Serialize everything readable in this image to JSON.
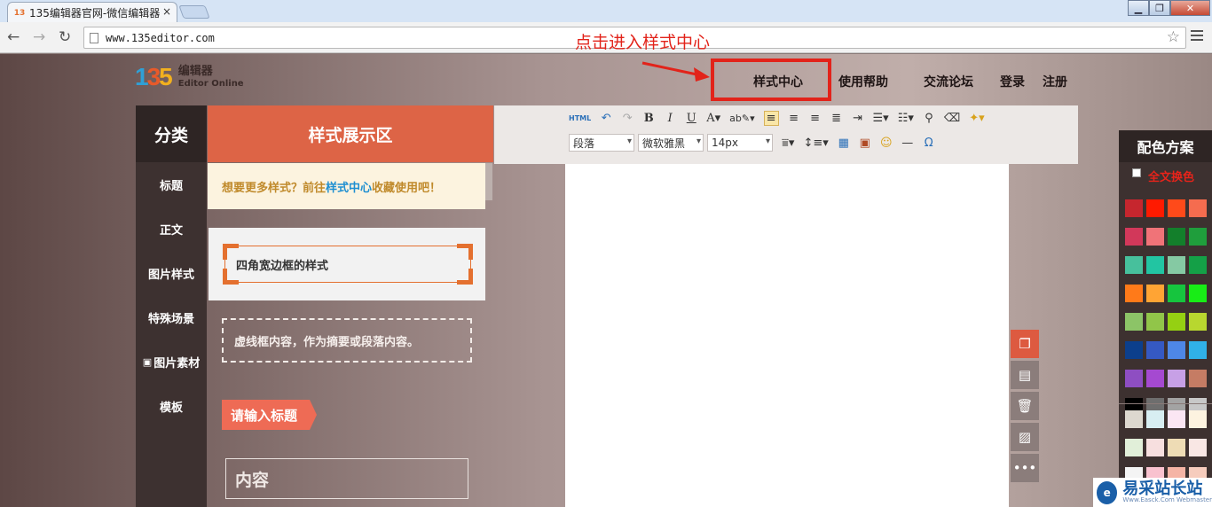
{
  "browser": {
    "tab_title": "135编辑器官网-微信编辑器",
    "tab_close": "×",
    "url": "www.135editor.com",
    "window_min": "▁",
    "window_max": "❐",
    "window_close": "✕"
  },
  "annotation": "点击进入样式中心",
  "logo": {
    "mark": "135",
    "name": "编辑器",
    "subtitle": "Editor Online"
  },
  "topnav": {
    "style_center": "样式中心",
    "help": "使用帮助",
    "forum": "交流论坛",
    "login": "登录",
    "register": "注册"
  },
  "categories": {
    "heading": "分类",
    "items": [
      "标题",
      "正文",
      "图片样式",
      "特殊场景",
      "图片素材",
      "模板"
    ]
  },
  "styles": {
    "heading": "样式展示区",
    "promo_prefix": "想要更多样式？前往",
    "promo_link": "样式中心",
    "promo_suffix": "收藏使用吧！",
    "sample_frame": "四角宽边框的样式",
    "sample_dashed": "虚线框内容，作为摘要或段落内容。",
    "sample_title": "请输入标题",
    "sample_content": "内容"
  },
  "editor": {
    "html_label": "HTML",
    "paragraph": "段落",
    "font": "微软雅黑",
    "size": "14px"
  },
  "color_scheme": {
    "heading": "配色方案",
    "full_change": "全文换色",
    "colors": [
      "#c6262e",
      "#ff1a00",
      "#ff4a1a",
      "#f56c4f",
      "#d2385a",
      "#f07378",
      "#137f2b",
      "#1f9e3c",
      "#47c09c",
      "#22c5a2",
      "#85c9a3",
      "#14a047",
      "#ff7a19",
      "#ffa434",
      "#16c53e",
      "#18ed16",
      "#8cc467",
      "#91c549",
      "#95d012",
      "#b8d72f",
      "#0c3f8c",
      "#3559c3",
      "#4e87e6",
      "#30b1e8",
      "#8e4ec2",
      "#a549d1",
      "#c7a0e6",
      "#c57c64",
      "#000000",
      "#6e6e6e",
      "#a3a3a3",
      "#c8c8c8"
    ],
    "colors_light": [
      "#ddd8cf",
      "#d8eef2",
      "#fbe6f3",
      "#fdf3e0",
      "#e1efd9",
      "#f7dfdf",
      "#eedcb5",
      "#f9e7e4",
      "#f4f4f4",
      "#f9c2cf",
      "#f5b4a5",
      "#f6ccbd"
    ]
  },
  "watermark": {
    "text": "易采站长站",
    "small": "Www.Easck.Com Webmaster"
  }
}
